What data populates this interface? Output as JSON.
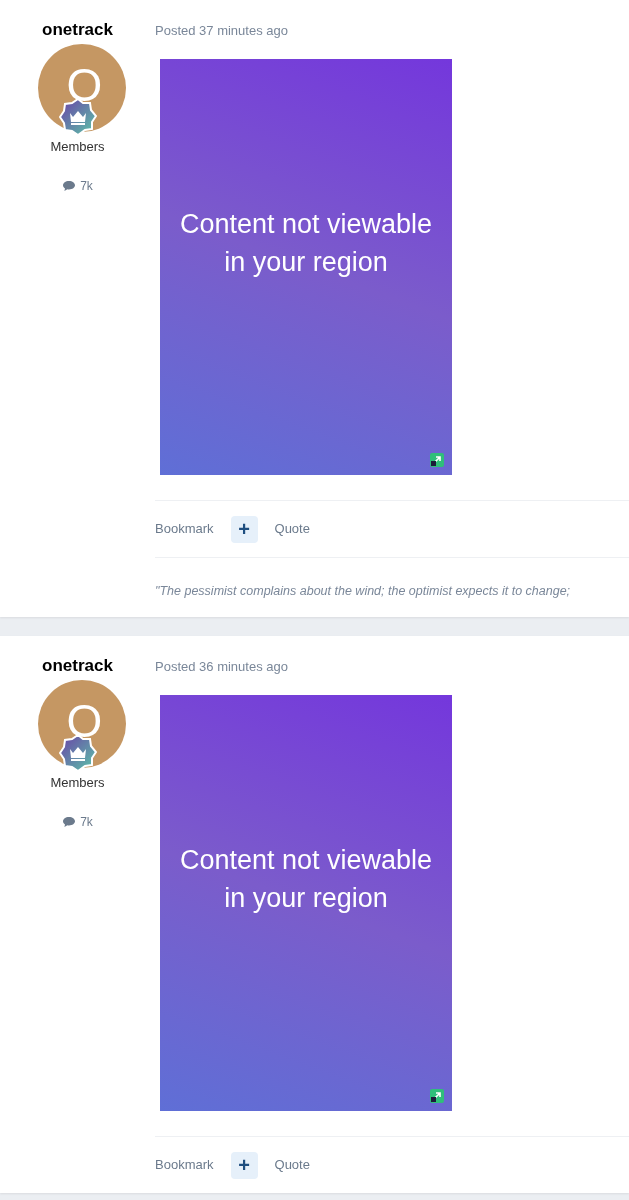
{
  "posts": [
    {
      "author": "onetrack",
      "avatar_letter": "O",
      "group": "Members",
      "post_count": "7k",
      "posted": "Posted 37 minutes ago",
      "embed": {
        "lines": [
          "Content not viewable",
          "in your region"
        ]
      },
      "actions": {
        "bookmark": "Bookmark",
        "add": "+",
        "quote": "Quote"
      },
      "signature": "\"The pessimist complains about the wind; the optimist expects it to change;"
    },
    {
      "author": "onetrack",
      "avatar_letter": "O",
      "group": "Members",
      "post_count": "7k",
      "posted": "Posted 36 minutes ago",
      "embed": {
        "lines": [
          "Content not viewable",
          "in your region"
        ]
      },
      "actions": {
        "bookmark": "Bookmark",
        "add": "+",
        "quote": "Quote"
      }
    }
  ]
}
